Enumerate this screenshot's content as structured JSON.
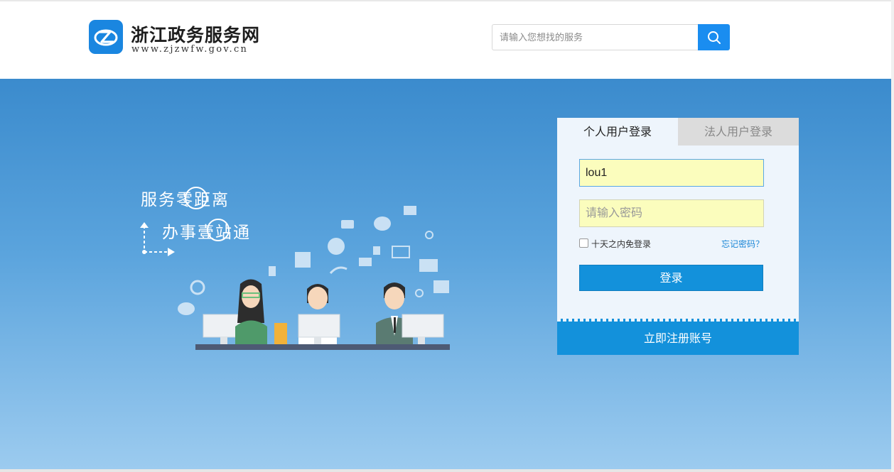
{
  "header": {
    "site_title": "浙江政务服务网",
    "site_url": "www.zjzwfw.gov.cn",
    "search_placeholder": "请输入您想找的服务"
  },
  "banner": {
    "slogan_line1": "服务零距离",
    "slogan_line2": "办事壹站通"
  },
  "login": {
    "tabs": [
      {
        "label": "个人用户登录",
        "active": true
      },
      {
        "label": "法人用户登录",
        "active": false
      }
    ],
    "username_value": "lou1",
    "password_placeholder": "请输入密码",
    "remember_label": "十天之内免登录",
    "forgot_label": "忘记密码？",
    "submit_label": "登录",
    "register_label": "立即注册账号"
  },
  "colors": {
    "brand_blue": "#1391db",
    "banner_top": "#3b8bcd",
    "banner_bottom": "#9ccbef",
    "autofill_yellow": "#fbfdbd"
  }
}
